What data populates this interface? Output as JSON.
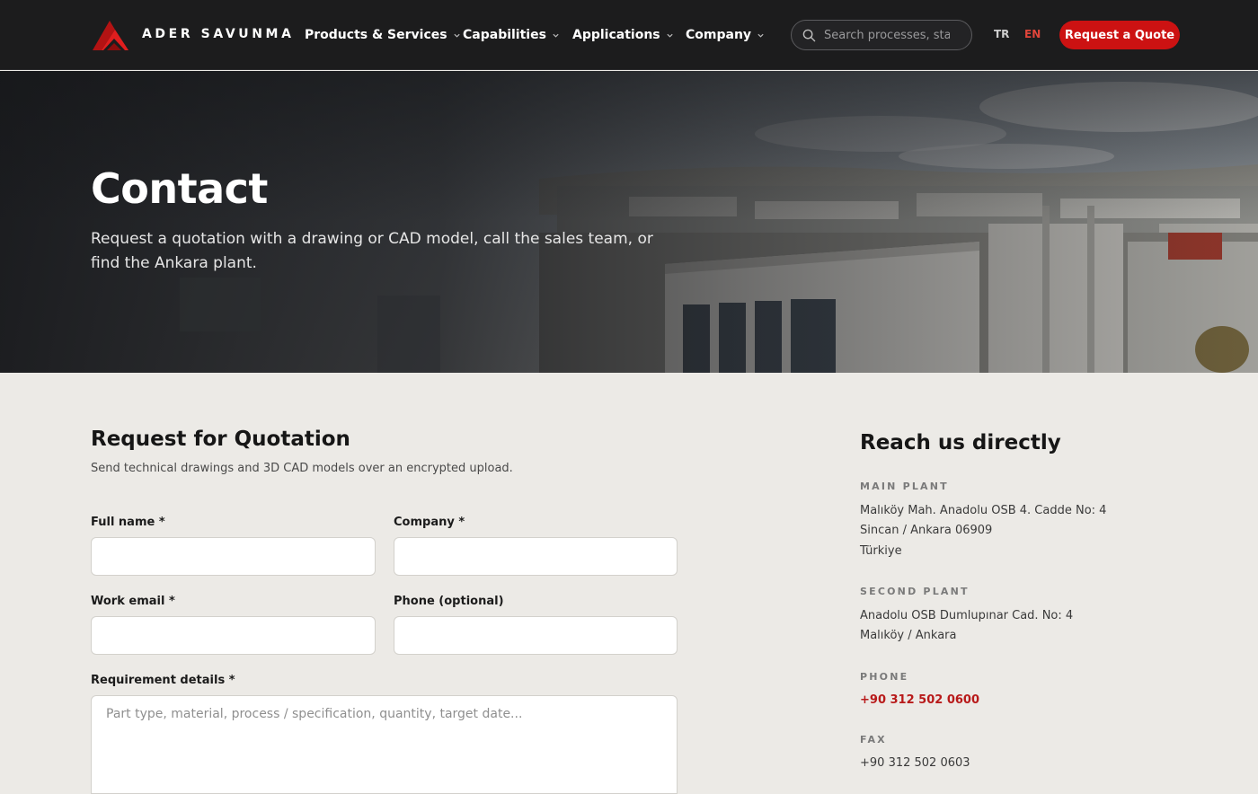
{
  "header": {
    "brand": "ADER SAVUNMA",
    "nav": [
      {
        "label": "Products & Services"
      },
      {
        "label": "Capabilities"
      },
      {
        "label": "Applications"
      },
      {
        "label": "Company"
      }
    ],
    "search_placeholder": "Search processes, standards...",
    "lang_tr": "TR",
    "lang_en": "EN",
    "cta_label": "Request a Quote"
  },
  "hero": {
    "title": "Contact",
    "subtitle": "Request a quotation with a drawing or CAD model, call the sales team, or find the Ankara plant."
  },
  "rfq": {
    "title": "Request for Quotation",
    "subtitle": "Send technical drawings and 3D CAD models over an encrypted upload.",
    "full_name_label": "Full name *",
    "company_label": "Company *",
    "email_label": "Work email *",
    "phone_label": "Phone (optional)",
    "details_label": "Requirement details *",
    "details_placeholder": "Part type, material, process / specification, quantity, target date..."
  },
  "contact": {
    "title": "Reach us directly",
    "main_plant_heading": "MAIN PLANT",
    "main_plant_lines": [
      "Malıköy Mah. Anadolu OSB 4. Cadde No: 4",
      "Sincan / Ankara 06909",
      "Türkiye"
    ],
    "second_plant_heading": "SECOND PLANT",
    "second_plant_lines": [
      "Anadolu OSB Dumlupınar Cad. No: 4",
      "Malıköy / Ankara"
    ],
    "phone_heading": "PHONE",
    "phone": "+90 312 502 0600",
    "fax_heading": "FAX",
    "fax": "+90 312 502 0603"
  },
  "colors": {
    "header_bg": "#1c1c1d",
    "accent_red": "#cc1212",
    "page_bg": "#eceae6",
    "link_red": "#b81a1a"
  }
}
